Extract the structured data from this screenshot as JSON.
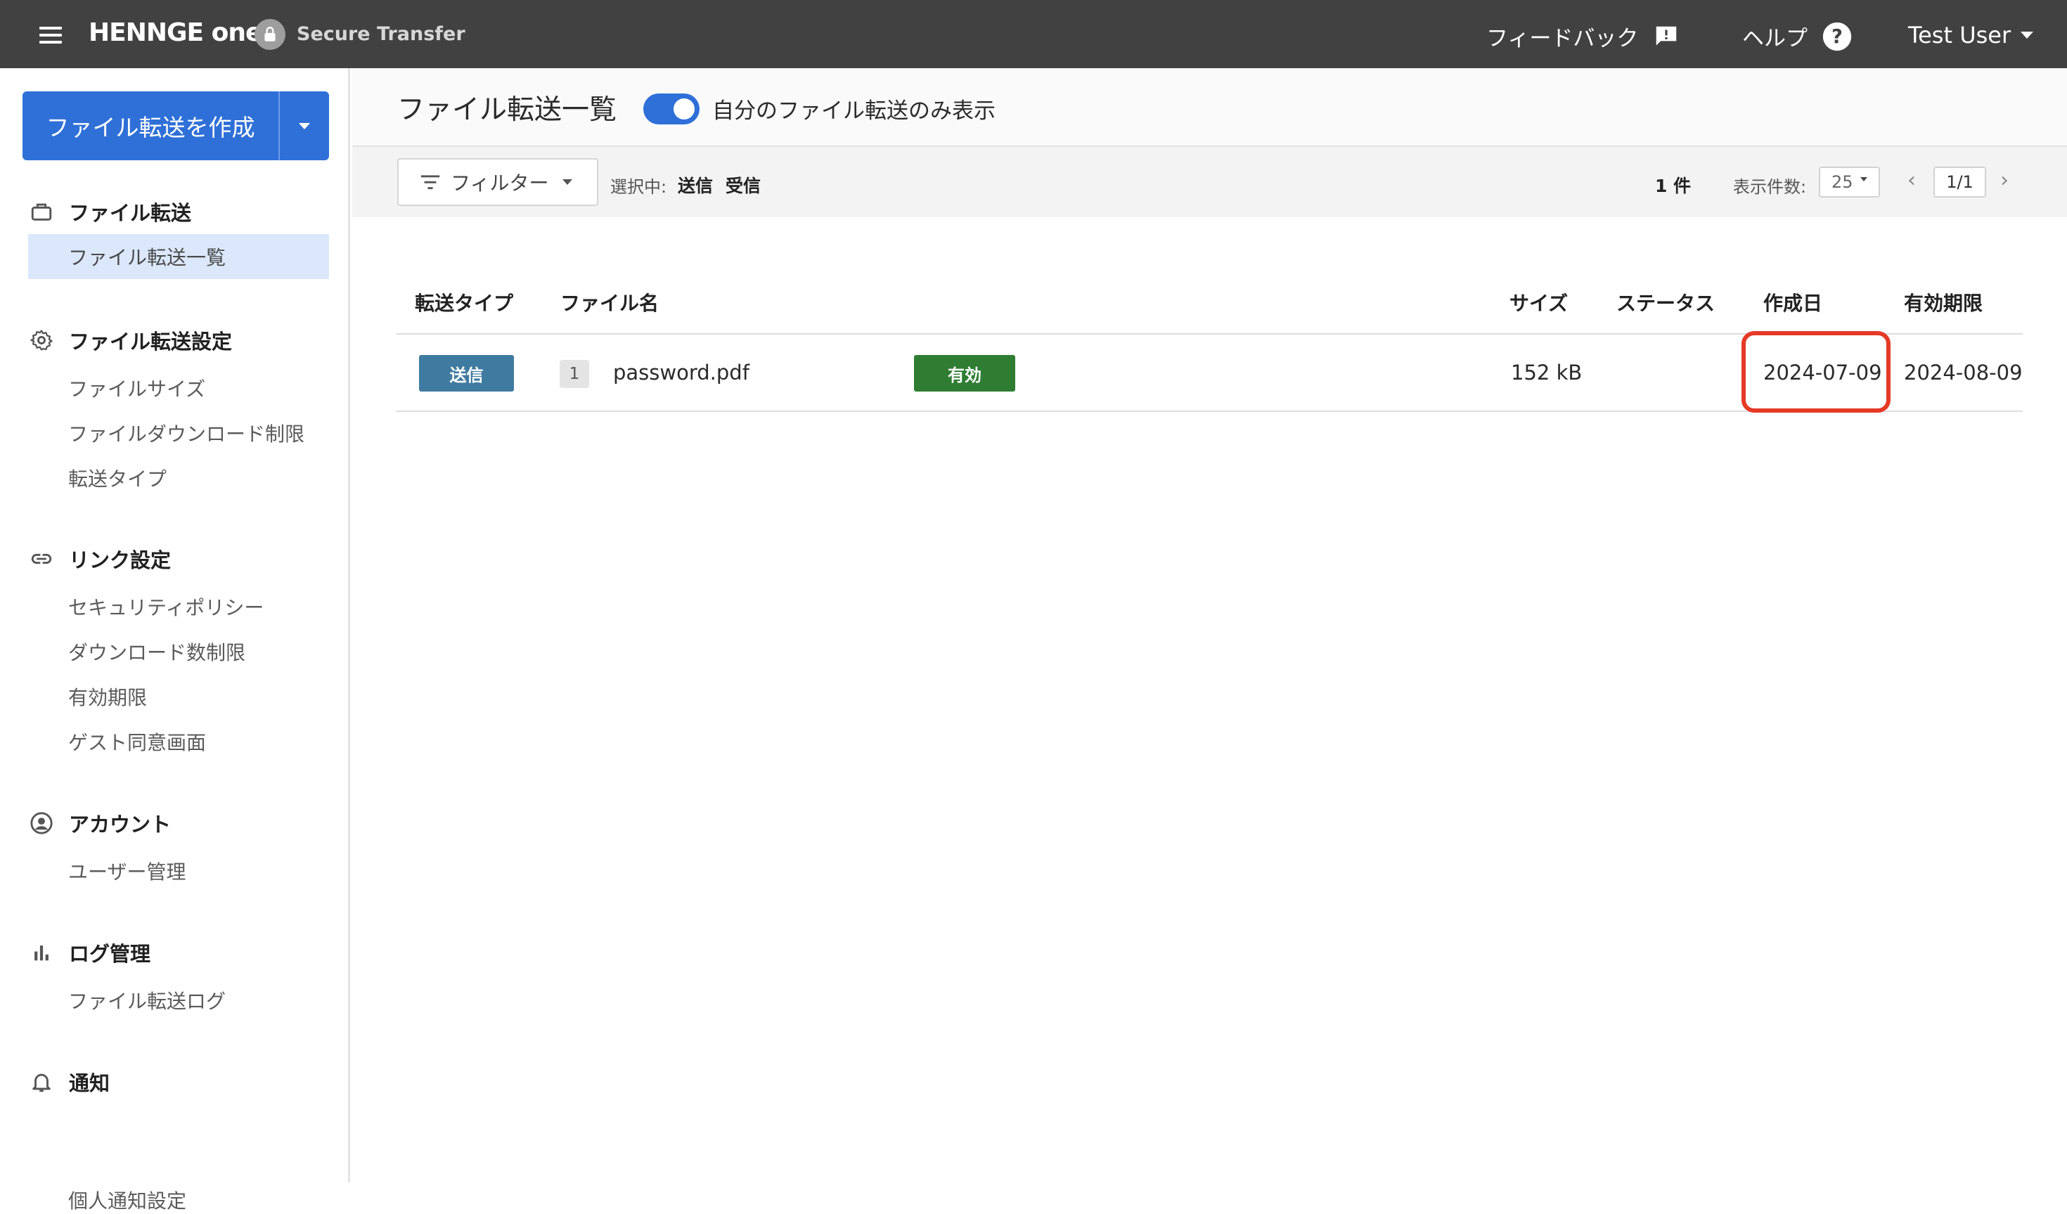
{
  "header": {
    "brand": "HENNGE one",
    "product": "Secure Transfer",
    "feedback_label": "フィードバック",
    "help_label": "ヘルプ",
    "user_label": "Test User"
  },
  "sidebar": {
    "create_button": "ファイル転送を作成",
    "sections": [
      {
        "title": "ファイル転送",
        "icon": "briefcase-icon",
        "items": [
          "ファイル転送一覧"
        ]
      },
      {
        "title": "ファイル転送設定",
        "icon": "gear-icon",
        "items": [
          "ファイルサイズ",
          "ファイルダウンロード制限",
          "転送タイプ"
        ]
      },
      {
        "title": "リンク設定",
        "icon": "link-icon",
        "items": [
          "セキュリティポリシー",
          "ダウンロード数制限",
          "有効期限",
          "ゲスト同意画面"
        ]
      },
      {
        "title": "アカウント",
        "icon": "account-circle-icon",
        "items": [
          "ユーザー管理"
        ]
      },
      {
        "title": "ログ管理",
        "icon": "bar-chart-icon",
        "items": [
          "ファイル転送ログ"
        ]
      },
      {
        "title": "通知",
        "icon": "bell-icon",
        "items": [
          "個人通知設定"
        ]
      }
    ],
    "active_item": "ファイル転送一覧"
  },
  "main": {
    "title": "ファイル転送一覧",
    "toggle_label": "自分のファイル転送のみ表示",
    "toggle_on": true,
    "toolbar": {
      "filter_label": "フィルター",
      "selected_label": "選択中:",
      "selected_tags": [
        "送信",
        "受信"
      ],
      "count": "1 件",
      "per_page_label": "表示件数:",
      "per_page_value": "25",
      "page": "1/1"
    },
    "table": {
      "columns": [
        "転送タイプ",
        "ファイル名",
        "サイズ",
        "ステータス",
        "作成日",
        "有効期限"
      ],
      "rows": [
        {
          "type": "送信",
          "file_count": "1",
          "file_name": "password.pdf",
          "size": "152 kB",
          "status": "有効",
          "created": "2024-07-09",
          "expires": "2024-08-09"
        }
      ]
    }
  },
  "colors": {
    "header_bg": "#414141",
    "accent": "#2f70d8",
    "type_badge": "#3f7ba0",
    "status_active": "#2e7d32",
    "highlight": "#e53a26"
  }
}
